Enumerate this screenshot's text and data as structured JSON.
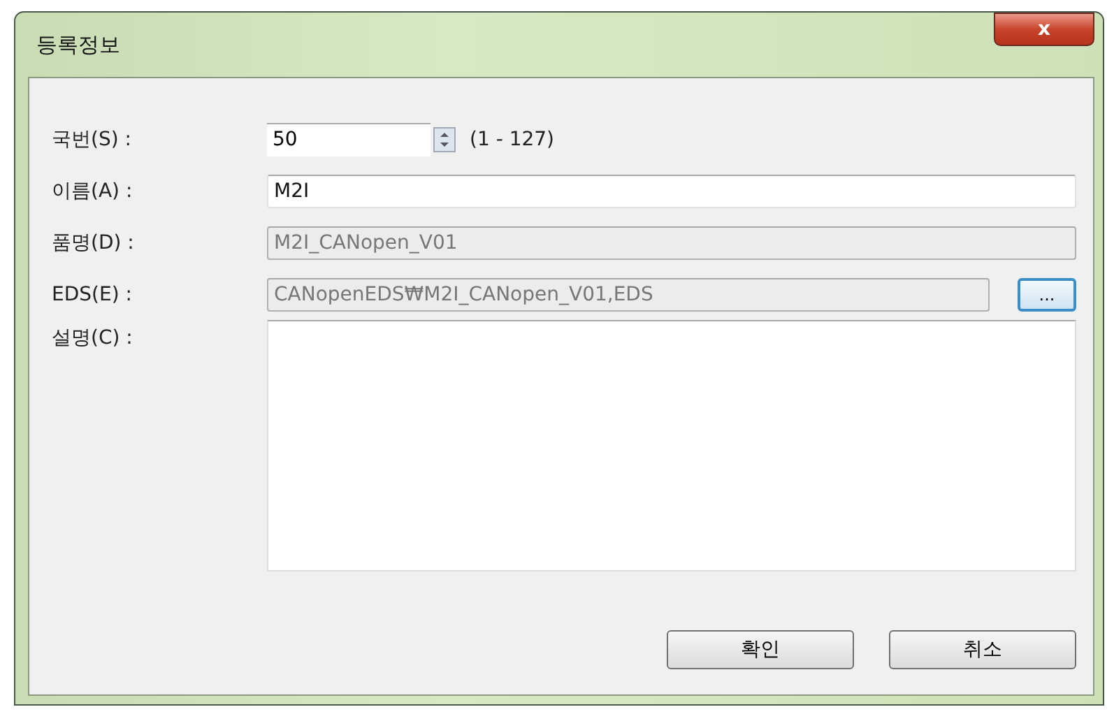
{
  "window": {
    "title": "등록정보",
    "close": "x"
  },
  "station": {
    "label": "국번(S) :",
    "value": "50",
    "range": "(1 - 127)"
  },
  "fields": [
    {
      "label": "이름(A) :",
      "value": "M2I",
      "disabled": false
    },
    {
      "label": "품명(D) :",
      "value": "M2I_CANopen_V01",
      "disabled": true
    }
  ],
  "eds": {
    "label": "EDS(E) :",
    "value": "CANopenEDS₩M2I_CANopen_V01,EDS",
    "disabled": true,
    "browse": "..."
  },
  "description": {
    "label": "설명(C) :"
  },
  "buttons": [
    "확인",
    "취소"
  ]
}
